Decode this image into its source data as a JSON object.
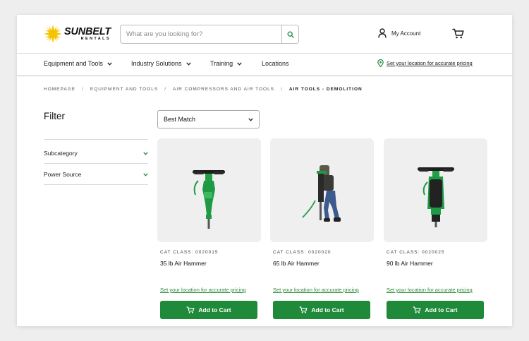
{
  "brand": {
    "name": "SUNBELT",
    "sub": "RENTALS"
  },
  "search": {
    "placeholder": "What are you looking for?"
  },
  "account": {
    "label": "My Account"
  },
  "nav": {
    "items": [
      {
        "label": "Equipment and Tools",
        "has_dropdown": true
      },
      {
        "label": "Industry Solutions",
        "has_dropdown": true
      },
      {
        "label": "Training",
        "has_dropdown": true
      },
      {
        "label": "Locations",
        "has_dropdown": false
      }
    ],
    "location_link": "Set your location for accurate pricing"
  },
  "breadcrumb": {
    "items": [
      "HOMEPAGE",
      "EQUIPMENT AND TOOLS",
      "AIR COMPRESSORS AND AIR TOOLS"
    ],
    "separator": "/",
    "current": "AIR TOOLS - DEMOLITION"
  },
  "filter": {
    "title": "Filter",
    "items": [
      {
        "label": "Subcategory"
      },
      {
        "label": "Power Source"
      }
    ]
  },
  "sort": {
    "selected": "Best Match"
  },
  "products": [
    {
      "cat_class": "CAT CLASS: 0020015",
      "name": "35 lb Air Hammer",
      "price_link": "Set your location for accurate pricing",
      "button": "Add to Cart"
    },
    {
      "cat_class": "CAT CLASS: 0020020",
      "name": "65 lb Air Hammer",
      "price_link": "Set your location for accurate pricing",
      "button": "Add to Cart"
    },
    {
      "cat_class": "CAT CLASS: 0020025",
      "name": "90 lb Air Hammer",
      "price_link": "Set your location for accurate pricing",
      "button": "Add to Cart"
    }
  ],
  "colors": {
    "accent_green": "#1e8a3a",
    "link_green": "#2e8b3a",
    "logo_yellow": "#f5c400"
  }
}
